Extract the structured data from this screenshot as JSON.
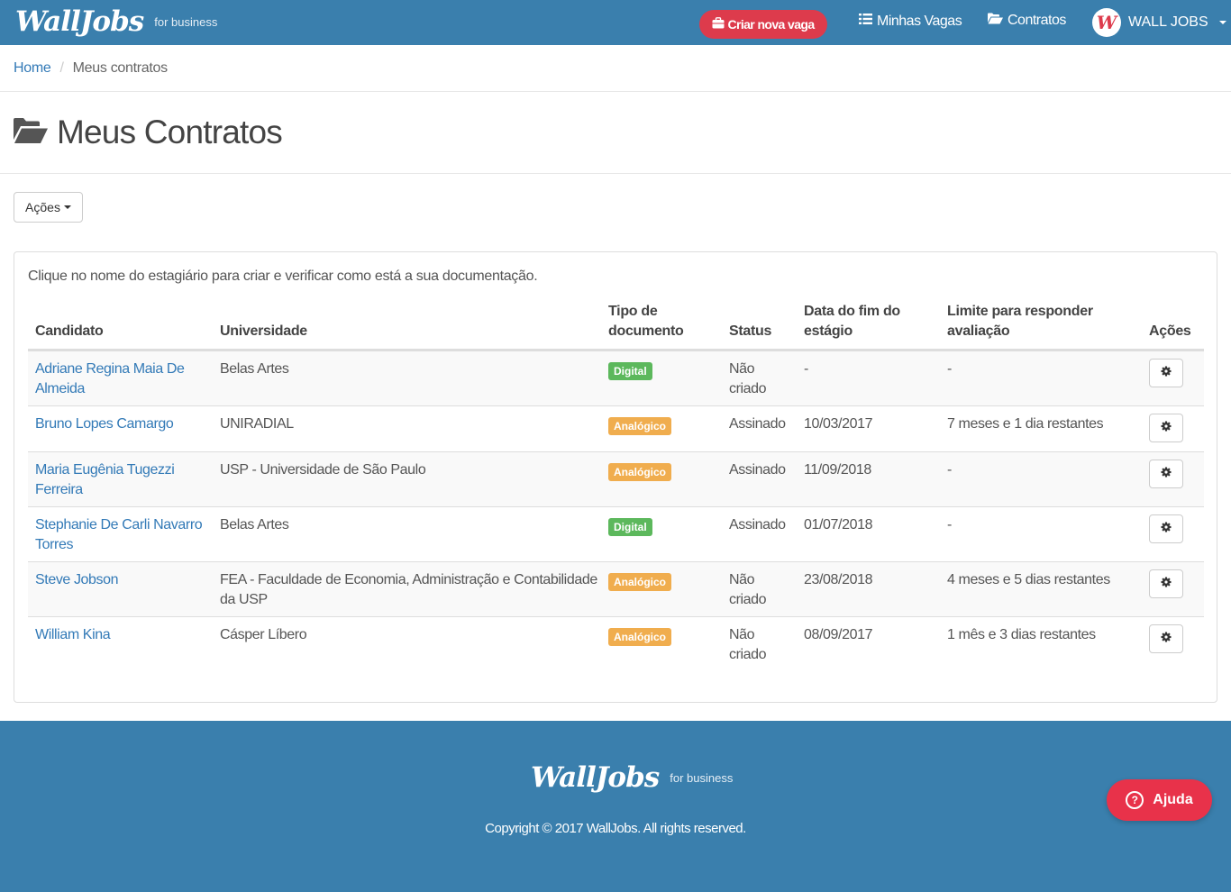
{
  "navbar": {
    "brand": "WallJobs",
    "brand_sub": "for business",
    "create_label": "Criar nova vaga",
    "my_jobs_label": "Minhas Vagas",
    "contracts_label": "Contratos",
    "user_label": "WALL JOBS",
    "user_logo_letter": "W"
  },
  "breadcrumb": {
    "home": "Home",
    "separator": "/",
    "current": "Meus contratos"
  },
  "page": {
    "title": "Meus Contratos",
    "actions_label": "Ações"
  },
  "panel": {
    "intro": "Clique no nome do estagiário para criar e verificar como está a sua documentação.",
    "headers": {
      "candidate": "Candidato",
      "university": "Universidade",
      "doc_type": [
        "Tipo de",
        "documento"
      ],
      "status": "Status",
      "end_date": [
        "Data do fim do",
        "estágio"
      ],
      "deadline": [
        "Limite para responder",
        "avaliação"
      ],
      "actions": "Ações"
    },
    "rows": [
      {
        "name": [
          "Adriane Regina Maia De",
          "Almeida"
        ],
        "university": [
          "Belas Artes"
        ],
        "doc_type": "Digital",
        "status": [
          "Não",
          "criado"
        ],
        "end_date": "-",
        "deadline": "-"
      },
      {
        "name": [
          "Bruno Lopes Camargo"
        ],
        "university": [
          "UNIRADIAL"
        ],
        "doc_type": "Analógico",
        "status": [
          "Assinado"
        ],
        "end_date": "10/03/2017",
        "deadline": "7 meses e 1 dia restantes"
      },
      {
        "name": [
          "Maria Eugênia Tugezzi",
          "Ferreira"
        ],
        "university": [
          "USP - Universidade de São Paulo"
        ],
        "doc_type": "Analógico",
        "status": [
          "Assinado"
        ],
        "end_date": "11/09/2018",
        "deadline": "-"
      },
      {
        "name": [
          "Stephanie De Carli Navarro",
          "Torres"
        ],
        "university": [
          "Belas Artes"
        ],
        "doc_type": "Digital",
        "status": [
          "Assinado"
        ],
        "end_date": "01/07/2018",
        "deadline": "-"
      },
      {
        "name": [
          "Steve Jobson"
        ],
        "university": [
          "FEA - Faculdade de Economia, Administração e Contabilidade",
          "da USP"
        ],
        "doc_type": "Analógico",
        "status": [
          "Não",
          "criado"
        ],
        "end_date": "23/08/2018",
        "deadline": "4 meses e 5 dias restantes"
      },
      {
        "name": [
          "William Kina"
        ],
        "university": [
          "Cásper Líbero"
        ],
        "doc_type": "Analógico",
        "status": [
          "Não",
          "criado"
        ],
        "end_date": "08/09/2017",
        "deadline": "1 mês e 3 dias restantes"
      }
    ],
    "badge_colors": {
      "Digital": "#5cb85c",
      "Analógico": "#f0ad4e"
    }
  },
  "footer": {
    "brand": "WallJobs",
    "brand_sub": "for business",
    "copyright": "Copyright © 2017 WallJobs. All rights reserved."
  },
  "help": {
    "label": "Ajuda",
    "icon_char": "?"
  },
  "icons": {
    "create": "briefcase-icon",
    "my_jobs": "list-icon",
    "contracts": "folder-open-icon",
    "title": "folder-open-icon",
    "row_action": "gear-icon",
    "help": "question-circle-icon"
  },
  "colors": {
    "navbar": "#3a7fad",
    "accent_red": "#dd3b4c",
    "link": "#337ab7"
  }
}
